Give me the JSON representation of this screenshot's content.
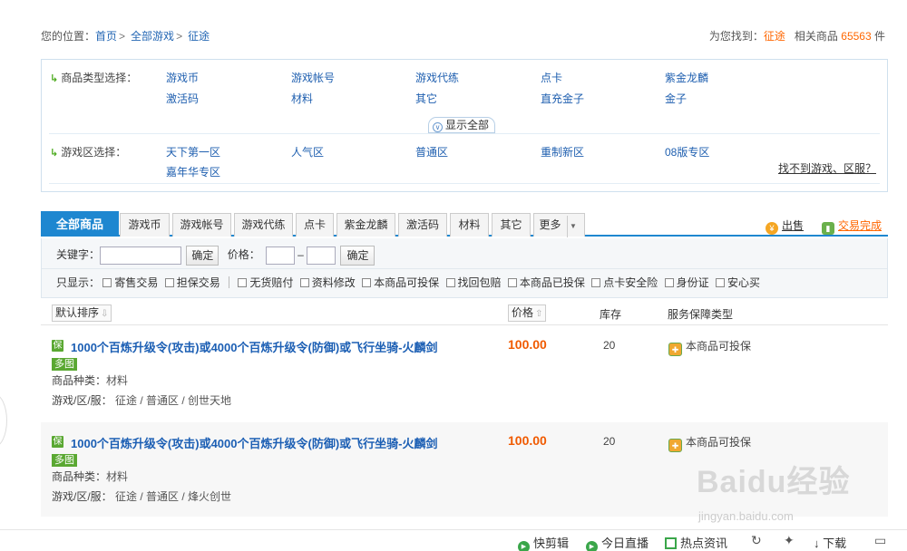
{
  "breadcrumb": {
    "prefix": "您的位置：",
    "items": [
      "首页",
      "全部游戏",
      "征途"
    ]
  },
  "found": {
    "label": "为您找到：",
    "game": "征途",
    "count_label": "相关商品",
    "count": "65563",
    "unit": "件"
  },
  "filters": {
    "type_label": "商品类型选择：",
    "type_items": [
      "游戏币",
      "游戏帐号",
      "游戏代练",
      "点卡",
      "紫金龙麟",
      "激活码",
      "材料",
      "其它",
      "直充金子",
      "金子"
    ],
    "show_all": "显示全部",
    "zone_label": "游戏区选择：",
    "zone_items": [
      "天下第一区",
      "人气区",
      "普通区",
      "重制新区",
      "08版专区",
      "嘉年华专区"
    ],
    "not_found": "找不到游戏、区服？"
  },
  "tabs": {
    "items": [
      "全部商品",
      "游戏币",
      "游戏帐号",
      "游戏代练",
      "点卡",
      "紫金龙麟",
      "激活码",
      "材料",
      "其它",
      "更多"
    ],
    "sell": "出售",
    "deal": "交易完成"
  },
  "search": {
    "keyword_label": "关键字：",
    "confirm": "确定",
    "price_label": "价格：",
    "dash": "–",
    "confirm2": "确定",
    "only_show": "只显示：",
    "options": [
      "寄售交易",
      "担保交易",
      "无货赔付",
      "资料修改",
      "本商品可投保",
      "找回包赔",
      "本商品已投保",
      "点卡安全险",
      "身份证",
      "安心买"
    ]
  },
  "list_header": {
    "sort": "默认排序",
    "price": "价格",
    "stock": "库存",
    "service": "服务保障类型"
  },
  "items": [
    {
      "badge": "保",
      "title": "1000个百炼升级令(攻击)或4000个百炼升级令(防御)或飞行坐骑-火麟剑",
      "tag": "多图",
      "kind_label": "商品种类：",
      "kind": "材料",
      "server_label": "游戏/区/服：",
      "server": "征途 / 普通区 / 创世天地",
      "price": "100.00",
      "stock": "20",
      "service": "本商品可投保"
    },
    {
      "badge": "保",
      "title": "1000个百炼升级令(攻击)或4000个百炼升级令(防御)或飞行坐骑-火麟剑",
      "tag": "多图",
      "kind_label": "商品种类：",
      "kind": "材料",
      "server_label": "游戏/区/服：",
      "server": "征途 / 普通区 / 烽火创世",
      "price": "100.00",
      "stock": "20",
      "service": "本商品可投保"
    }
  ],
  "bottombar": {
    "clip": "快剪辑",
    "live": "今日直播",
    "news": "热点资讯",
    "download": "下载"
  },
  "watermark": {
    "big": "Baidu经验",
    "small": "jingyan.baidu.com"
  }
}
